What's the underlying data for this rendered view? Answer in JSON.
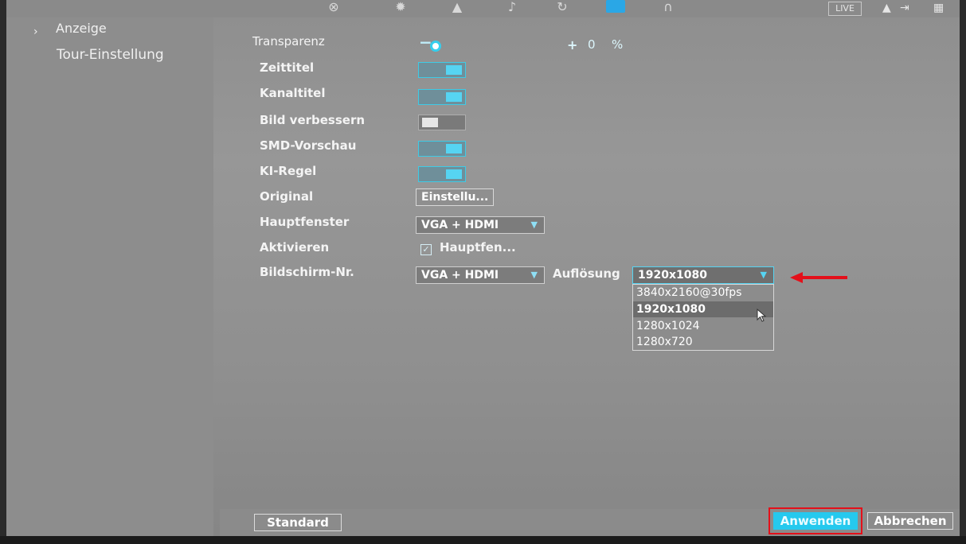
{
  "sidebar": {
    "items": [
      {
        "label": "Anzeige",
        "active": true
      },
      {
        "label": "Tour-Einstellung",
        "active": false
      }
    ]
  },
  "topbar": {
    "icons": [
      "camera-icon",
      "settings-icon",
      "alarm-icon",
      "audio-icon",
      "sync-icon",
      "monitor-icon",
      "headphones-icon"
    ],
    "live_label": "LIVE",
    "right_icons": [
      "user-icon",
      "logout-icon",
      "qr-icon"
    ]
  },
  "settings": {
    "transparency": {
      "label": "Transparenz",
      "minus": "−",
      "plus": "+",
      "value": "0",
      "unit": "%"
    },
    "time_title": {
      "label": "Zeittitel",
      "on": true
    },
    "channel_title": {
      "label": "Kanaltitel",
      "on": true
    },
    "image_enhance": {
      "label": "Bild verbessern",
      "on": false
    },
    "smd_preview": {
      "label": "SMD-Vorschau",
      "on": true
    },
    "ai_rule": {
      "label": "KI-Regel",
      "on": true
    },
    "original": {
      "label": "Original",
      "button": "Einstellu..."
    },
    "main_window": {
      "label": "Hauptfenster",
      "value": "VGA + HDMI"
    },
    "activate": {
      "label": "Aktivieren",
      "checkbox_label": "Hauptfen...",
      "checked": true
    },
    "screen_no": {
      "label": "Bildschirm-Nr.",
      "value": "VGA + HDMI"
    },
    "resolution": {
      "label": "Auflösung",
      "value": "1920x1080",
      "options": [
        "3840x2160@30fps",
        "1920x1080",
        "1280x1024",
        "1280x720"
      ],
      "highlighted": "1920x1080"
    }
  },
  "footer": {
    "default_label": "Standard",
    "apply_label": "Anwenden",
    "cancel_label": "Abbrechen"
  },
  "colors": {
    "accent": "#25c9ee",
    "annotation": "#e4101a"
  }
}
